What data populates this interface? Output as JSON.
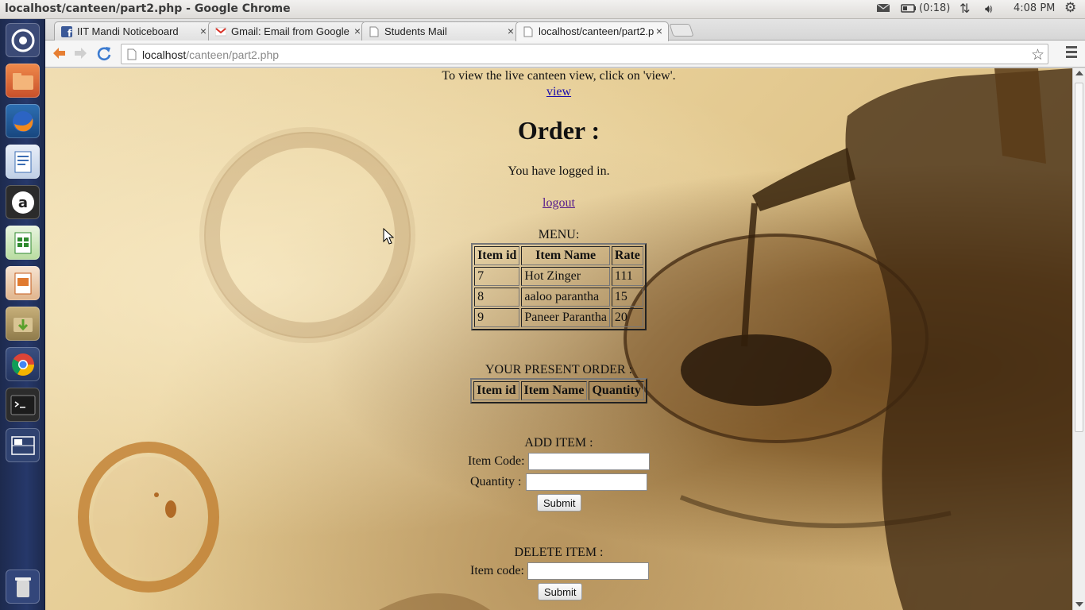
{
  "window": {
    "title": "localhost/canteen/part2.php - Google Chrome"
  },
  "tray": {
    "battery": "(0:18)",
    "clock": "4:08 PM"
  },
  "launcher": {
    "items": [
      "dash-home",
      "files",
      "firefox",
      "writer",
      "amazon",
      "calc",
      "impress",
      "software-updater",
      "chrome",
      "terminal",
      "workspace-switcher",
      "trash"
    ]
  },
  "tabs": [
    {
      "label": "IIT Mandi Noticeboard",
      "close": "×"
    },
    {
      "label": "Gmail: Email from Google",
      "close": "×"
    },
    {
      "label": "Students Mail",
      "close": "×"
    },
    {
      "label": "localhost/canteen/part2.p",
      "close": "×"
    }
  ],
  "toolbar": {
    "url_host": "localhost",
    "url_path": "/canteen/part2.php"
  },
  "page": {
    "intro": "To view the live canteen view, click on 'view'.",
    "view_link": "view",
    "heading": "Order :",
    "logged_in": "You have logged in.",
    "logout_link": "logout",
    "menu_caption": "MENU:",
    "menu_headers": [
      "Item id",
      "Item Name",
      "Rate"
    ],
    "menu_rows": [
      [
        "7",
        "Hot Zinger",
        "111"
      ],
      [
        "8",
        "aaloo parantha",
        "15"
      ],
      [
        "9",
        "Paneer Parantha",
        "20"
      ]
    ],
    "order_caption": "YOUR PRESENT ORDER :",
    "order_headers": [
      "Item id",
      "Item Name",
      "Quantity"
    ],
    "add_caption": "ADD ITEM :",
    "add_code_label": "Item Code:",
    "add_qty_label": "Quantity :",
    "add_submit": "Submit",
    "delete_caption": "DELETE ITEM :",
    "delete_code_label": "Item code:",
    "delete_submit": "Submit"
  }
}
